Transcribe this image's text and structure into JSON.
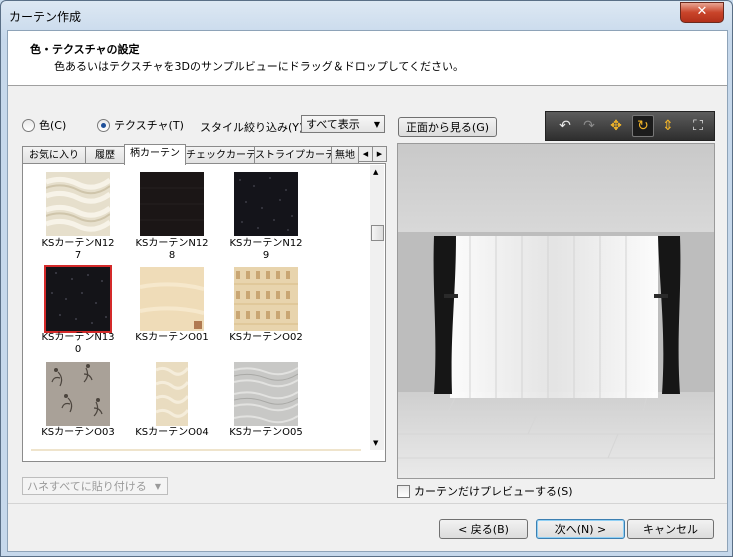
{
  "window": {
    "title": "カーテン作成",
    "close_symbol": "✕"
  },
  "header": {
    "title": "色・テクスチャの設定",
    "subtitle": "色あるいはテクスチャを3Dのサンプルビューにドラッグ＆ドロップしてください。"
  },
  "mode": {
    "color_label": "色(C)",
    "texture_label": "テクスチャ(T)",
    "selected": "texture"
  },
  "style_filter": {
    "label": "スタイル絞り込み(Y):",
    "value": "すべて表示"
  },
  "front_view_button": "正面から見る(G)",
  "tabs": [
    {
      "label": "お気に入り"
    },
    {
      "label": "履歴"
    },
    {
      "label": "柄カーテン"
    },
    {
      "label": "チェックカーテン"
    },
    {
      "label": "ストライプカーテン"
    },
    {
      "label": "無地"
    }
  ],
  "active_tab": 2,
  "swatches": [
    {
      "label_line1": "KSカーテンN12",
      "label_line2": "7",
      "kind": "cream-wave",
      "selected": false
    },
    {
      "label_line1": "KSカーテンN12",
      "label_line2": "8",
      "kind": "black",
      "selected": false
    },
    {
      "label_line1": "KSカーテンN12",
      "label_line2": "9",
      "kind": "black-speckle",
      "selected": false
    },
    {
      "label_line1": "KSカーテンN13",
      "label_line2": "0",
      "kind": "black-speckle",
      "selected": true
    },
    {
      "label_line1": "KSカーテンO01",
      "label_line2": "",
      "kind": "cream-plain",
      "selected": false
    },
    {
      "label_line1": "KSカーテンO02",
      "label_line2": "",
      "kind": "beige-grid",
      "selected": false
    },
    {
      "label_line1": "KSカーテンO03",
      "label_line2": "",
      "kind": "floral-gray",
      "selected": false
    },
    {
      "label_line1": "KSカーテンO04",
      "label_line2": "",
      "kind": "cream-wave-narrow",
      "selected": false
    },
    {
      "label_line1": "KSカーテンO05",
      "label_line2": "",
      "kind": "gray-textured",
      "selected": false
    }
  ],
  "paste_all_label": "ハネすべてに貼り付ける",
  "preview_only_checkbox": {
    "label": "カーテンだけプレビューする(S)",
    "checked": false
  },
  "toolbar_icons": [
    "undo-icon",
    "redo-icon",
    "move-icon",
    "rotate-icon",
    "height-icon",
    "fit-view-icon"
  ],
  "buttons": {
    "back": "< 戻る(B)",
    "next": "次へ(N) >",
    "cancel": "キャンセル"
  },
  "colors": {
    "titlebar": "#c6d8eb",
    "close_button": "#c9442a",
    "selection_outline": "#d42a2a",
    "curtain_dark": "#1a1a1a",
    "toolbar_bg": "#3a3a3a",
    "toolbar_active": "#f0b429"
  }
}
